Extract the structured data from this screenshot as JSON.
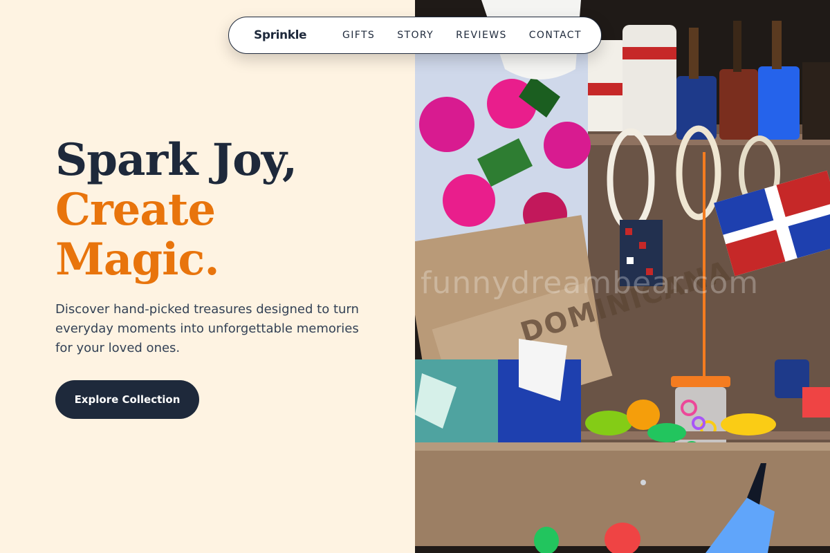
{
  "nav": {
    "brand": "Sprinkle",
    "links": [
      {
        "label": "GIFTS"
      },
      {
        "label": "STORY"
      },
      {
        "label": "REVIEWS"
      },
      {
        "label": "CONTACT"
      }
    ]
  },
  "hero": {
    "headline_line1": "Spark Joy,",
    "headline_line2": "Create",
    "headline_line3": "Magic.",
    "subtitle": "Discover hand-picked treasures designed to turn everyday moments into unforgettable memories for your loved ones.",
    "cta_label": "Explore Collection"
  },
  "image": {
    "bag_print": "DOMINICANA",
    "watermark": "funnydreambear.com"
  },
  "colors": {
    "background": "#fef3e2",
    "text_dark": "#1e293b",
    "accent_orange": "#e8740c"
  }
}
